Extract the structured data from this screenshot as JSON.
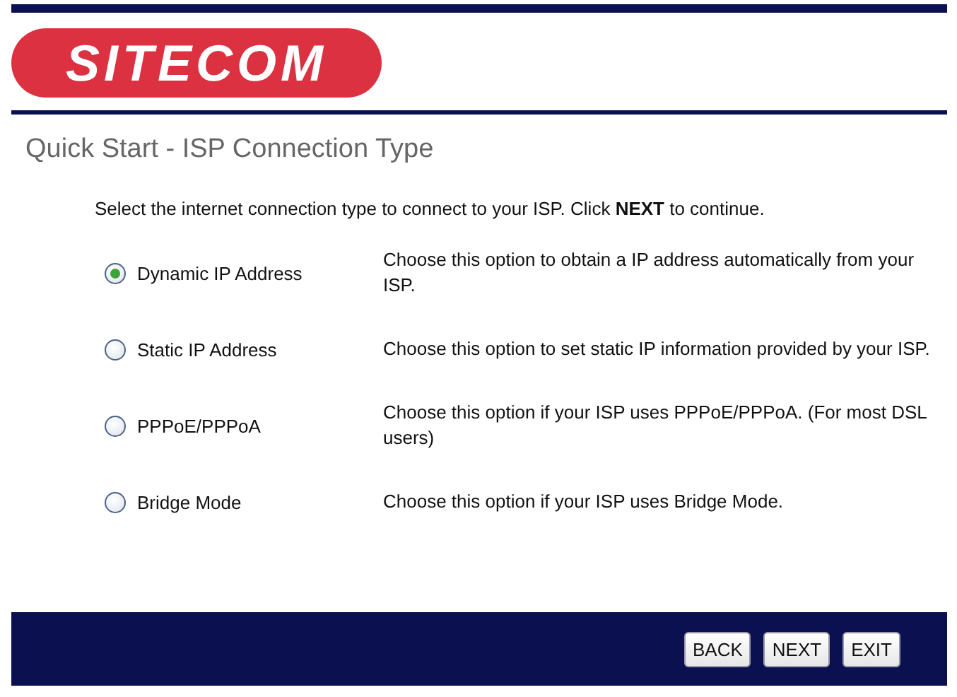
{
  "logo": {
    "text": "SITECOM"
  },
  "title": "Quick Start - ISP Connection Type",
  "instruction": "Select the internet connection type to connect to your ISP. Click **NEXT** to continue.",
  "options": [
    {
      "label": "Dynamic IP Address",
      "selected": true,
      "description": "Choose this option to obtain a IP address automatically from your ISP."
    },
    {
      "label": "Static IP Address",
      "selected": false,
      "description": "Choose this option to set static IP information provided by your ISP."
    },
    {
      "label": "PPPoE/PPPoA",
      "selected": false,
      "description": "Choose this option if your ISP uses PPPoE/PPPoA. (For most DSL users)"
    },
    {
      "label": "Bridge Mode",
      "selected": false,
      "description": "Choose this option if your ISP uses Bridge Mode."
    }
  ],
  "buttons": [
    "BACK",
    "NEXT",
    "EXIT"
  ]
}
